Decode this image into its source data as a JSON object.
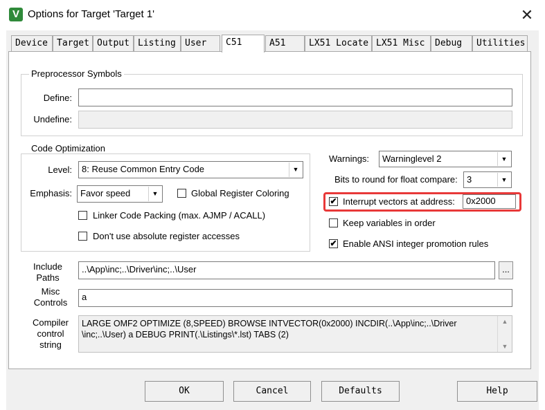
{
  "window": {
    "title": "Options for Target 'Target 1'",
    "close_glyph": "✕",
    "app_icon": "keil-uvision-icon"
  },
  "tabs": [
    {
      "label": "Device"
    },
    {
      "label": "Target"
    },
    {
      "label": "Output"
    },
    {
      "label": "Listing"
    },
    {
      "label": "User"
    },
    {
      "label": "C51",
      "active": true
    },
    {
      "label": "A51"
    },
    {
      "label": "LX51 Locate"
    },
    {
      "label": "LX51 Misc"
    },
    {
      "label": "Debug"
    },
    {
      "label": "Utilities"
    }
  ],
  "preprocessor": {
    "legend": "Preprocessor Symbols",
    "define_label": "Define:",
    "define_value": "",
    "undefine_label": "Undefine:",
    "undefine_value": ""
  },
  "code_opt": {
    "legend": "Code Optimization",
    "level_label": "Level:",
    "level_value": "8: Reuse Common Entry Code",
    "emphasis_label": "Emphasis:",
    "emphasis_value": "Favor speed",
    "global_reg": "Global Register Coloring",
    "linker_packing": "Linker Code Packing (max. AJMP / ACALL)",
    "dont_use_abs": "Don't use absolute register accesses"
  },
  "right": {
    "warnings_label": "Warnings:",
    "warnings_value": "Warninglevel 2",
    "bits_label": "Bits to round for float compare:",
    "bits_value": "3",
    "interrupt_label": "Interrupt vectors at address:",
    "interrupt_value": "0x2000",
    "interrupt_checked": true,
    "keep_vars": "Keep variables in order",
    "keep_vars_checked": false,
    "ansi": "Enable ANSI integer promotion rules",
    "ansi_checked": true
  },
  "paths": {
    "include_label_1": "Include",
    "include_label_2": "Paths",
    "include_value": "..\\App\\inc;..\\Driver\\inc;..\\User",
    "browse_label": "...",
    "misc_label_1": "Misc",
    "misc_label_2": "Controls",
    "misc_value": "a",
    "compiler_label_1": "Compiler",
    "compiler_label_2": "control",
    "compiler_label_3": "string",
    "compiler_line_1": "LARGE OMF2 OPTIMIZE (8,SPEED) BROWSE INTVECTOR(0x2000) INCDIR(..\\App\\inc;..\\Driver",
    "compiler_line_2": "\\inc;..\\User) a DEBUG PRINT(.\\Listings\\*.lst) TABS (2)"
  },
  "buttons": {
    "ok": "OK",
    "cancel": "Cancel",
    "defaults": "Defaults",
    "help": "Help"
  },
  "check_glyph": "✔",
  "colors": {
    "highlight": "#e83838"
  }
}
